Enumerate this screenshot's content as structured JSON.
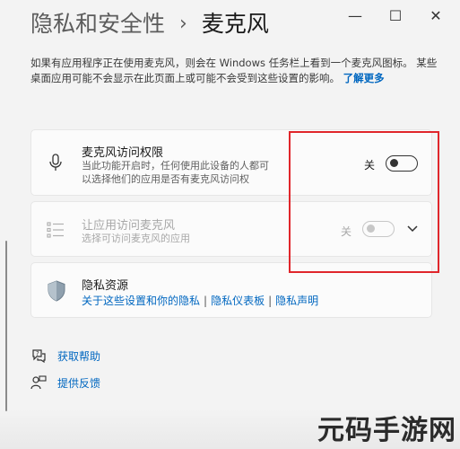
{
  "header": {
    "parent": "隐私和安全性",
    "separator": "›",
    "current": "麦克风"
  },
  "window_controls": {
    "minimize": "—",
    "maximize": "☐",
    "close": "✕"
  },
  "description": {
    "text": "如果有应用程序正在使用麦克风，则会在 Windows 任务栏上看到一个麦克风图标。 某些桌面应用可能不会显示在此页面上或可能不会受到这些设置的影响。",
    "link": "了解更多"
  },
  "mic_access": {
    "title": "麦克风访问权限",
    "subtitle_1": "当此功能开启时，任何使用此设备的人都可",
    "subtitle_2": "以选择他们的应用是否有麦克风访问权",
    "toggle_label": "关",
    "on": false
  },
  "app_access": {
    "title": "让应用访问麦克风",
    "subtitle": "选择可访问麦克风的应用",
    "toggle_label": "关",
    "on": false
  },
  "privacy": {
    "title": "隐私资源",
    "links": [
      "关于这些设置和你的隐私",
      "隐私仪表板",
      "隐私声明"
    ],
    "pipe": "|"
  },
  "help": {
    "get_help": "获取帮助",
    "feedback": "提供反馈"
  },
  "watermark": "元码手游网",
  "colors": {
    "accent": "#0067c0",
    "highlight": "#e0262b"
  }
}
